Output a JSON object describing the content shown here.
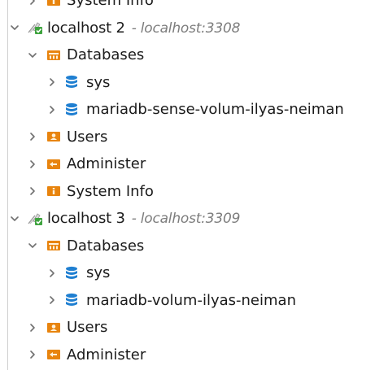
{
  "tree": {
    "nodes": [
      {
        "level": 1,
        "expanded": false,
        "icon": "system-info-icon",
        "label": "System Info"
      },
      {
        "level": 0,
        "expanded": true,
        "icon": "connection-ok-icon",
        "label": "localhost 2",
        "separator": "-",
        "sublabel": "localhost:3308"
      },
      {
        "level": 1,
        "expanded": true,
        "icon": "databases-folder-icon",
        "label": "Databases"
      },
      {
        "level": 2,
        "expanded": false,
        "icon": "database-icon",
        "label": "sys"
      },
      {
        "level": 2,
        "expanded": false,
        "icon": "database-icon",
        "label": "mariadb-sense-volum-ilyas-neiman"
      },
      {
        "level": 1,
        "expanded": false,
        "icon": "users-folder-icon",
        "label": "Users"
      },
      {
        "level": 1,
        "expanded": false,
        "icon": "administer-icon",
        "label": "Administer"
      },
      {
        "level": 1,
        "expanded": false,
        "icon": "system-info-icon",
        "label": "System Info"
      },
      {
        "level": 0,
        "expanded": true,
        "icon": "connection-ok-icon",
        "label": "localhost 3",
        "separator": "-",
        "sublabel": "localhost:3309"
      },
      {
        "level": 1,
        "expanded": true,
        "icon": "databases-folder-icon",
        "label": "Databases"
      },
      {
        "level": 2,
        "expanded": false,
        "icon": "database-icon",
        "label": "sys"
      },
      {
        "level": 2,
        "expanded": false,
        "icon": "database-icon",
        "label": "mariadb-volum-ilyas-neiman"
      },
      {
        "level": 1,
        "expanded": false,
        "icon": "users-folder-icon",
        "label": "Users"
      },
      {
        "level": 1,
        "expanded": false,
        "icon": "administer-icon",
        "label": "Administer"
      }
    ]
  },
  "colors": {
    "folder_orange": "#e8840e",
    "database_blue": "#1f7fd1",
    "connection_green": "#3ea33e",
    "chevron": "#707070",
    "sublabel": "#7d7d7d"
  }
}
